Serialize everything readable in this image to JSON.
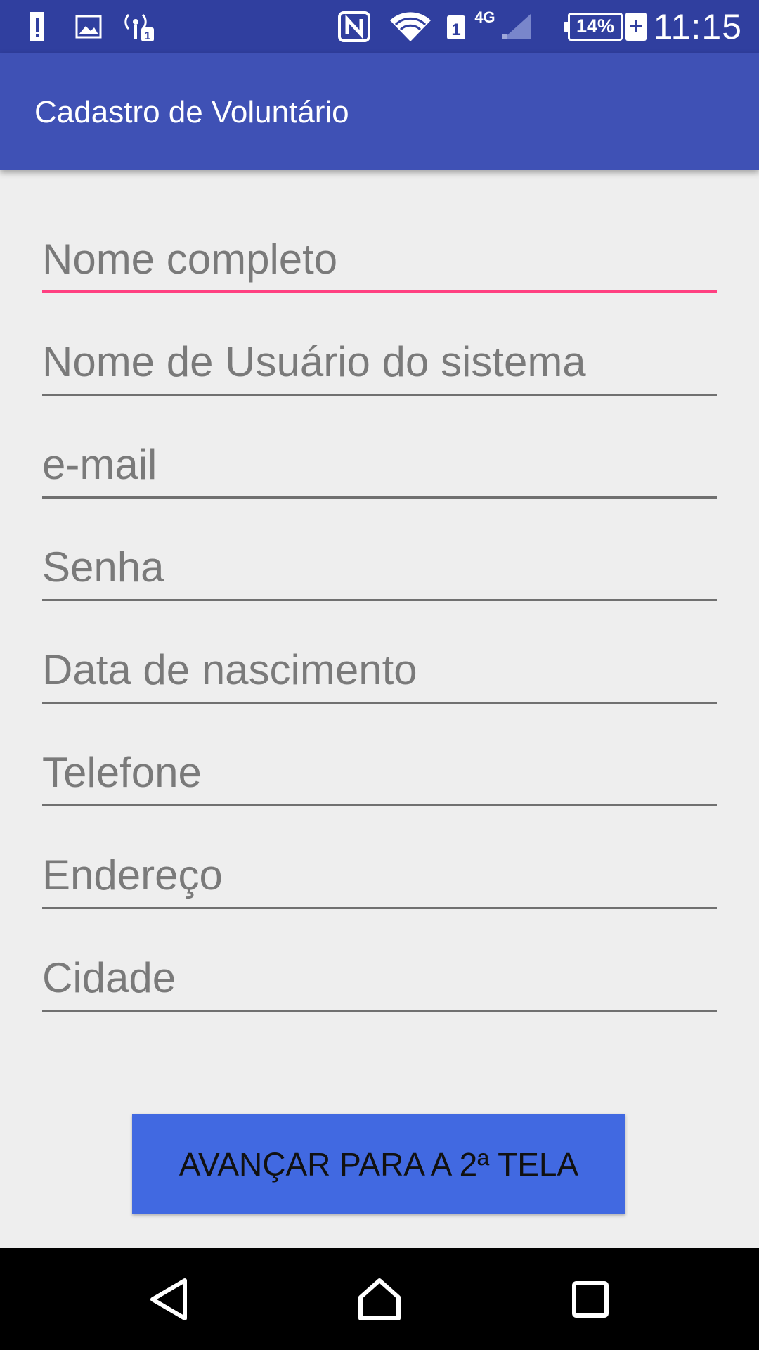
{
  "colors": {
    "status_bar": "#303f9f",
    "app_bar": "#3f51b5",
    "accent_focus": "#ff4081",
    "button": "#4169e1",
    "background": "#eeeeee"
  },
  "status_bar": {
    "left_icons": [
      "alert-icon",
      "image-icon",
      "signal-tower-icon"
    ],
    "right_icons": [
      "nfc-icon",
      "wifi-icon",
      "sim1-icon",
      "4g-icon",
      "cell-signal-icon",
      "battery-icon"
    ],
    "sim_label": "1",
    "network_label": "4G",
    "battery_level": "14%",
    "charging": "+",
    "time": "11:15"
  },
  "app_bar": {
    "title": "Cadastro de Voluntário"
  },
  "form": {
    "fields": [
      {
        "placeholder": "Nome completo",
        "focused": true
      },
      {
        "placeholder": "Nome de Usuário do sistema"
      },
      {
        "placeholder": "e-mail"
      },
      {
        "placeholder": "Senha"
      },
      {
        "placeholder": "Data de nascimento"
      },
      {
        "placeholder": "Telefone"
      },
      {
        "placeholder": "Endereço"
      },
      {
        "placeholder": "Cidade"
      }
    ],
    "submit_label": "AVANÇAR PARA A 2ª TELA"
  },
  "nav_bar": {
    "buttons": [
      "back-icon",
      "home-icon",
      "recents-icon"
    ]
  }
}
